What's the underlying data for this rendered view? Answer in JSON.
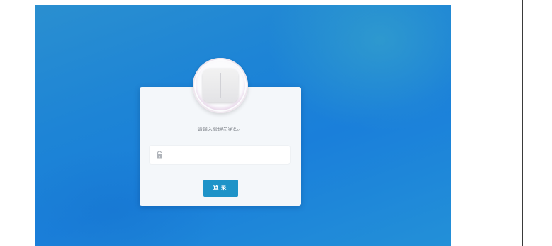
{
  "login": {
    "prompt": "请输入管理员密码。",
    "password_value": "",
    "password_placeholder": "",
    "submit_label": "登录"
  },
  "icons": {
    "device": "router-device-icon",
    "lock": "lock-icon"
  },
  "colors": {
    "background": "#1d84d6",
    "card": "#f4f7fa",
    "button": "#1e93c8"
  }
}
